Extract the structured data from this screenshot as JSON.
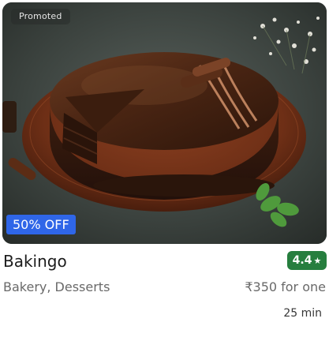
{
  "card": {
    "promoted_label": "Promoted",
    "offer_label": "50% OFF",
    "restaurant_name": "Bakingo",
    "rating": "4.4",
    "rating_icon": "star-icon",
    "cuisines": "Bakery, Desserts",
    "price": "₹350 for one",
    "delivery_time": "25 min",
    "image_subject": "chocolate-cake-image"
  },
  "colors": {
    "rating_bg": "#267e3e",
    "offer_bg": "#2f66e8",
    "text_primary": "#1c1c1c",
    "text_secondary": "#696969"
  }
}
